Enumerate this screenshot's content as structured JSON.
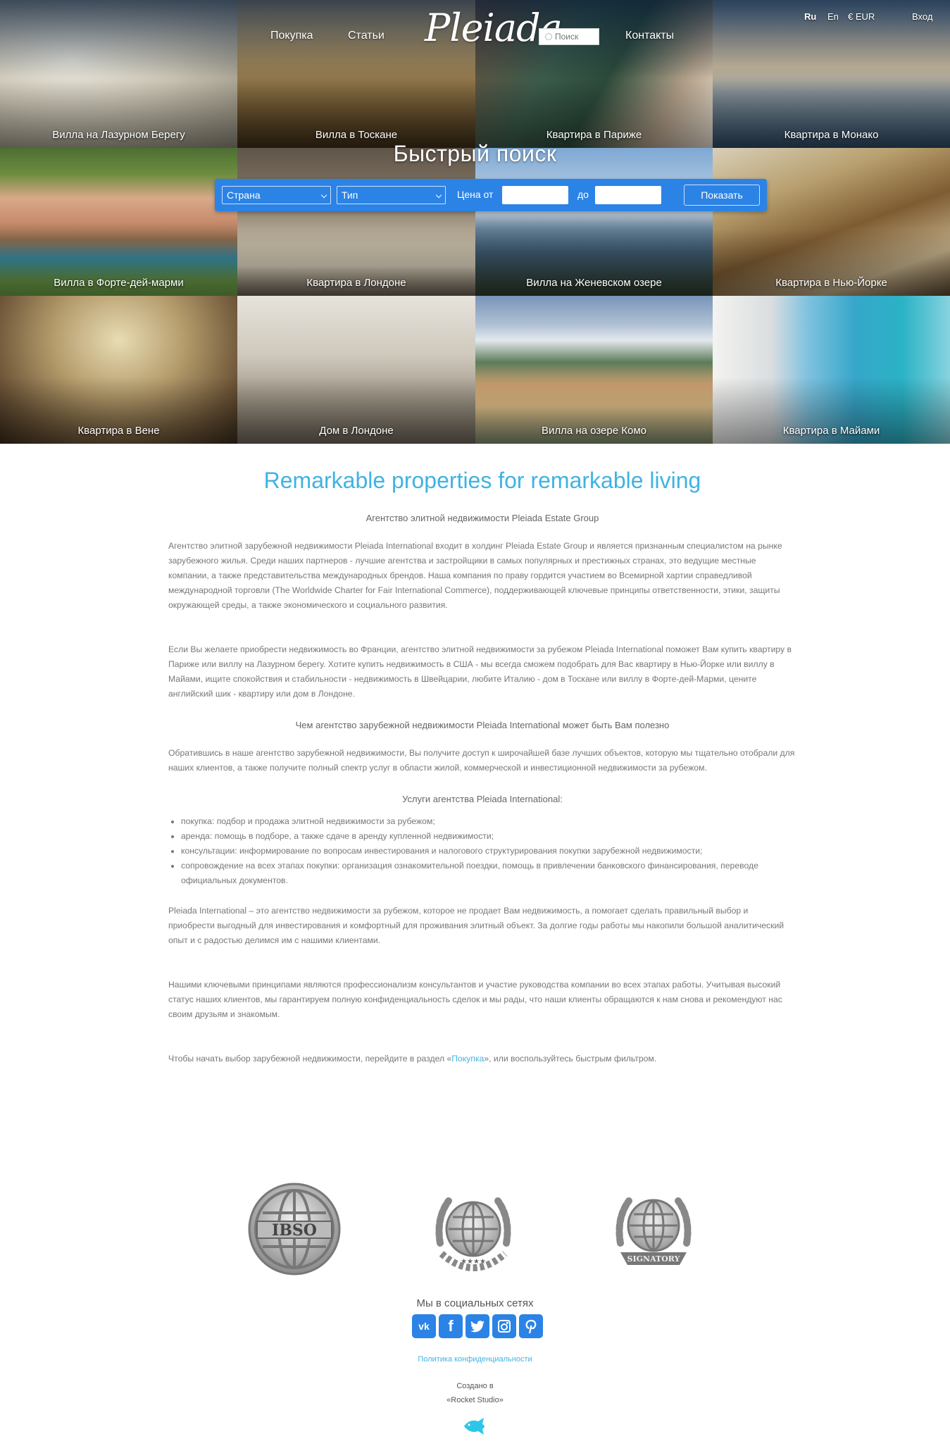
{
  "nav": {
    "buy": "Покупка",
    "articles": "Статьи",
    "logo": "Pleiada",
    "search_placeholder": "Поиск",
    "contacts": "Контакты",
    "lang_ru": "Ru",
    "lang_en": "En",
    "currency": "€ EUR",
    "login": "Вход"
  },
  "tiles": [
    "Вилла на Лазурном Берегу",
    "Вилла в Тоскане",
    "Квартира в Париже",
    "Квартира в Монако",
    "Вилла в Форте-дей-марми",
    "Квартира в Лондоне",
    "Вилла на Женевском озере",
    "Квартира в Нью-Йорке",
    "Квартира в Вене",
    "Дом в Лондоне",
    "Вилла на озере Комо",
    "Квартира в Майами"
  ],
  "quick_search": {
    "title": "Быстрый поиск",
    "country": "Страна",
    "type": "Тип",
    "price_from": "Цена от",
    "price_to": "до",
    "button": "Показать"
  },
  "content": {
    "title": "Remarkable properties for remarkable living",
    "subtitle": "Агентство элитной недвижимости Pleiada Estate Group",
    "p1": "Агентство элитной зарубежной недвижимости Pleiada International входит в холдинг Pleiada Estate Group и является признанным специалистом на рынке зарубежного жилья. Среди наших партнеров - лучшие агентства и застройщики в самых популярных и престижных странах, это ведущие местные компании, а также представительства международных брендов. Наша компания по праву гордится участием во Всемирной хартии справедливой международной торговли (The Worldwide Charter for Fair International Commerce), поддерживающей ключевые принципы ответственности, этики, защиты окружающей среды, а также экономического и социального развития.",
    "p2": "Если Вы желаете приобрести недвижимость во Франции, агентство элитной недвижимости за рубежом Pleiada International поможет Вам купить квартиру в Париже или виллу на Лазурном берегу. Хотите купить недвижимость в США - мы всегда сможем подобрать для Вас квартиру в Нью-Йорке или виллу в Майами, ищите спокойствия и стабильности - недвижимость в Швейцарии, любите Италию - дом в Тоскане или виллу в Форте-дей-Марми, цените английский шик - квартиру или дом в Лондоне.",
    "h2": "Чем агентство зарубежной недвижимости Pleiada International может быть Вам полезно",
    "p3": "Обратившись в наше агентство зарубежной недвижимости, Вы получите доступ к широчайшей базе лучших объектов, которую мы тщательно отобрали для наших клиентов, а также получите полный спектр услуг в области жилой, коммерческой и инвестиционной недвижимости за рубежом.",
    "h3": "Услуги агентства Pleiada International:",
    "services": [
      "покупка: подбор и продажа элитной недвижимости за рубежом;",
      "аренда: помощь в подборе, а также сдаче в аренду купленной недвижимости;",
      "консультации: информирование по вопросам инвестирования и налогового структурирования покупки зарубежной недвижимости;",
      "сопровождение на всех этапах покупки: организация ознакомительной поездки, помощь в привлечении банковского финансирования, переводе официальных документов."
    ],
    "p4": "Pleiada International – это агентство недвижимости за рубежом, которое не продает Вам недвижимость, а помогает сделать правильный выбор и приобрести выгодный для инвестирования и комфортный для проживания элитный объект. За долгие годы работы мы накопили большой аналитический опыт и с радостью делимся им с нашими клиентами.",
    "p5": "Нашими ключевыми принципами являются профессионализм консультантов и участие руководства компании во всех этапах работы. Учитывая высокий статус наших клиентов, мы гарантируем полную конфиденциальность сделок и мы рады, что наши клиенты обращаются к нам снова и рекомендуют нас своим друзьям и знакомым.",
    "p6_before": "Чтобы начать выбор зарубежной недвижимости, перейдите в раздел «",
    "p6_link": "Покупка",
    "p6_after": "», или воспользуйтесь быстрым фильтром."
  },
  "badges": {
    "ibso": "IBSO",
    "charter": "Worldwide Charter for Fair International Commerce",
    "signatory": "SIGNATORY"
  },
  "footer": {
    "social_title": "Мы в социальных сетях",
    "icons": [
      "vk-icon",
      "facebook-icon",
      "twitter-icon",
      "instagram-icon",
      "pinterest-icon"
    ],
    "privacy": "Политика конфиденциальности",
    "made_line1": "Создано в",
    "made_line2": "«Rocket Studio»"
  },
  "colors": {
    "accent": "#3fb3e3",
    "button": "#2b83e6"
  }
}
